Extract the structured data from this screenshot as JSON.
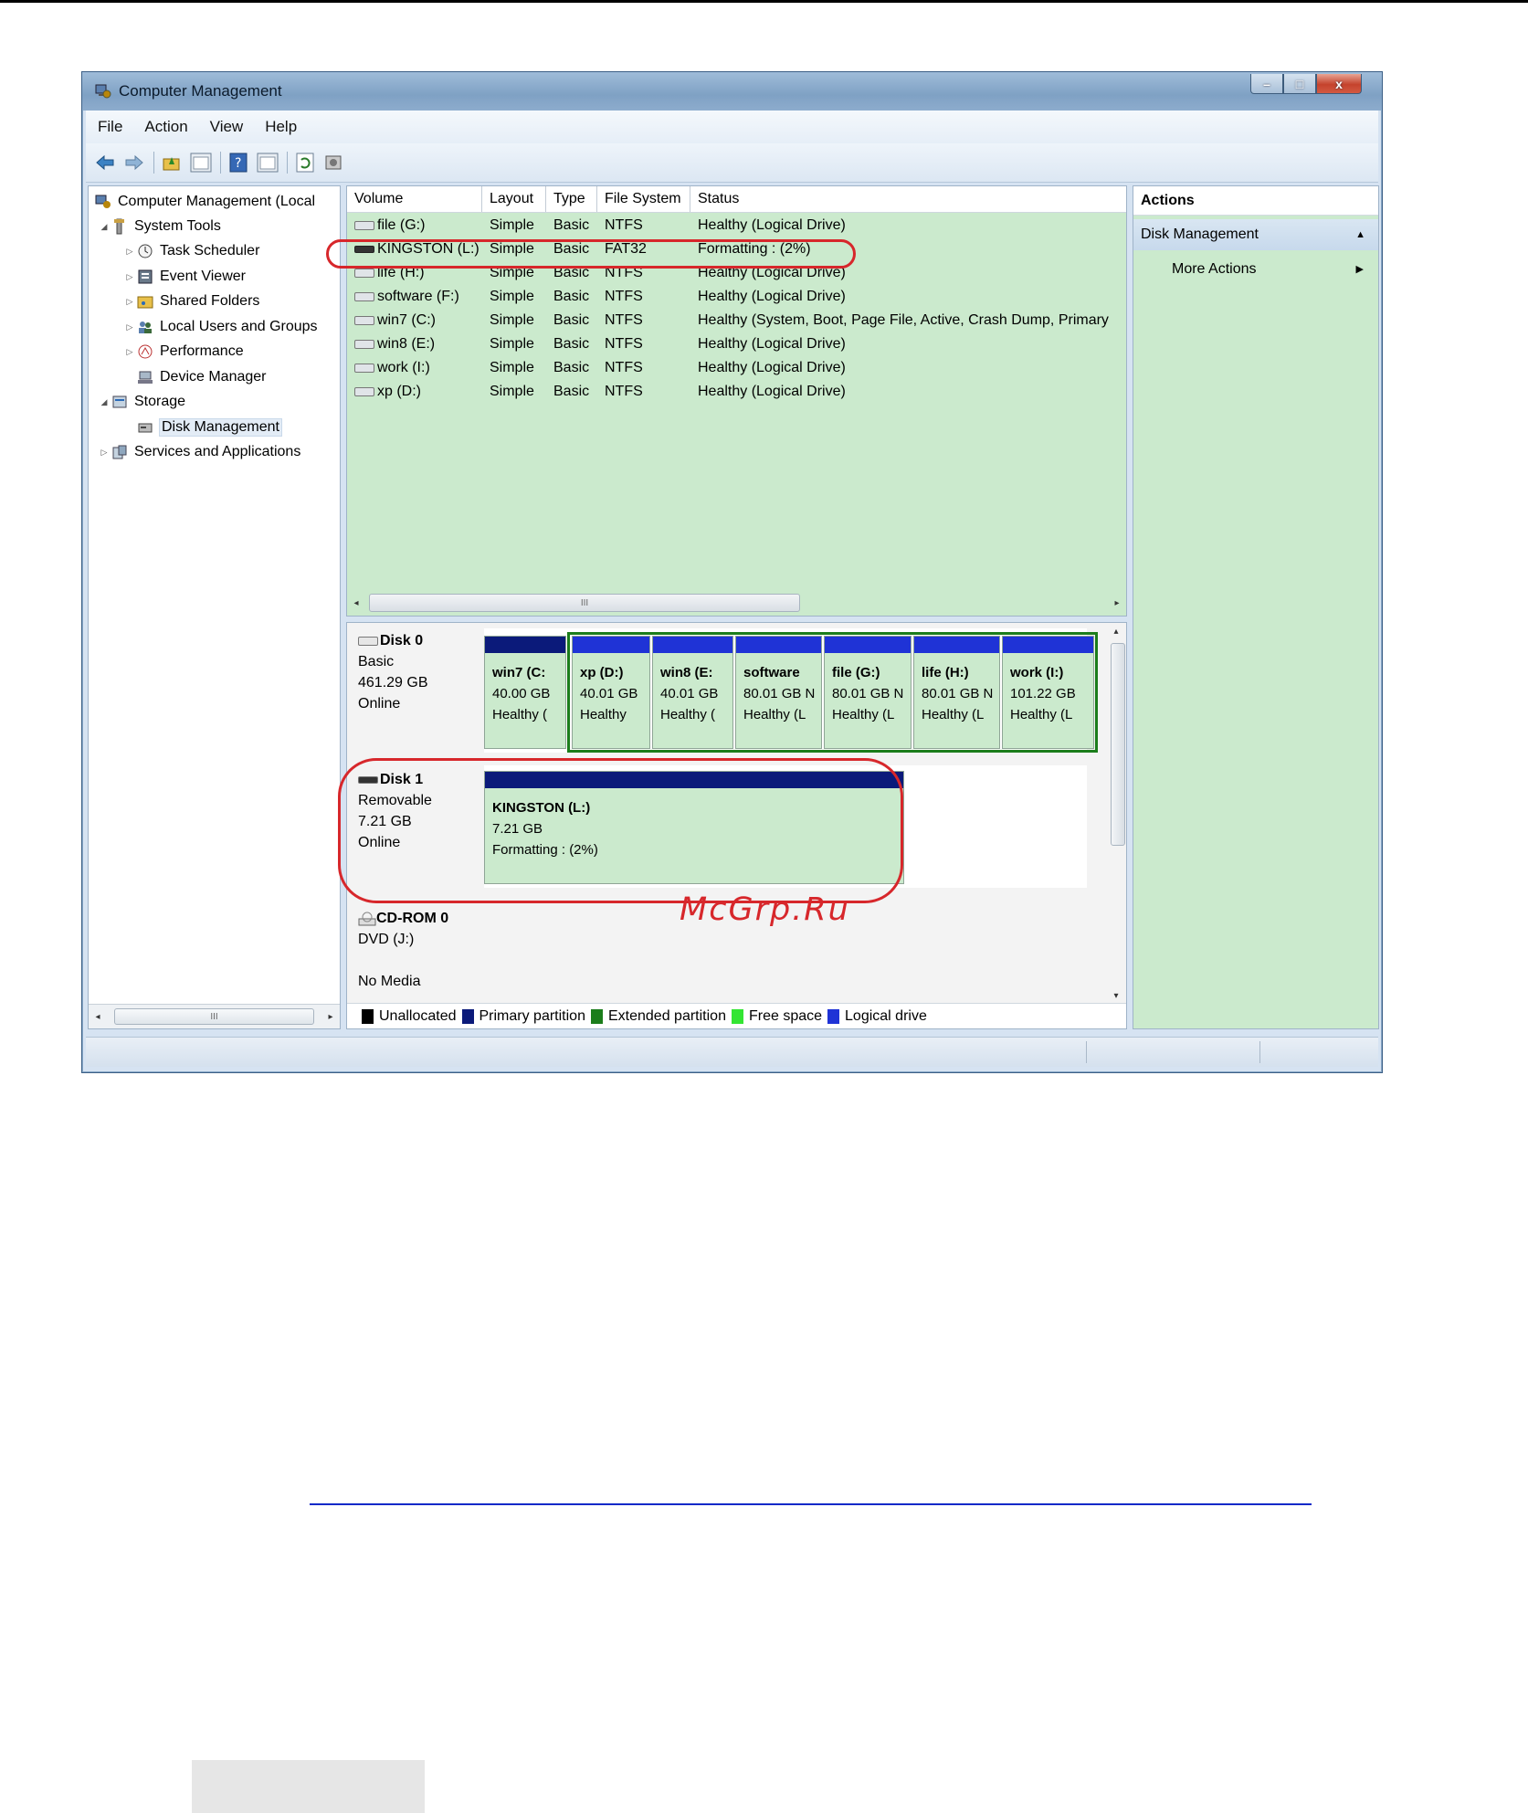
{
  "window": {
    "title": "Computer Management",
    "caption": {
      "minimize": "–",
      "maximize": "□",
      "close": "x"
    }
  },
  "menu": [
    "File",
    "Action",
    "View",
    "Help"
  ],
  "tree": {
    "root": "Computer Management (Local",
    "system_tools": "System Tools",
    "task_scheduler": "Task Scheduler",
    "event_viewer": "Event Viewer",
    "shared_folders": "Shared Folders",
    "local_users": "Local Users and Groups",
    "performance": "Performance",
    "device_manager": "Device Manager",
    "storage": "Storage",
    "disk_management": "Disk Management",
    "services": "Services and Applications",
    "scroll_thumb": "III"
  },
  "volumes": {
    "columns": [
      "Volume",
      "Layout",
      "Type",
      "File System",
      "Status"
    ],
    "rows": [
      {
        "volume": "file (G:)",
        "layout": "Simple",
        "type": "Basic",
        "fs": "NTFS",
        "status": "Healthy (Logical Drive)"
      },
      {
        "volume": "KINGSTON (L:)",
        "layout": "Simple",
        "type": "Basic",
        "fs": "FAT32",
        "status": "Formatting : (2%)"
      },
      {
        "volume": "life (H:)",
        "layout": "Simple",
        "type": "Basic",
        "fs": "NTFS",
        "status": "Healthy (Logical Drive)"
      },
      {
        "volume": "software (F:)",
        "layout": "Simple",
        "type": "Basic",
        "fs": "NTFS",
        "status": "Healthy (Logical Drive)"
      },
      {
        "volume": "win7 (C:)",
        "layout": "Simple",
        "type": "Basic",
        "fs": "NTFS",
        "status": "Healthy (System, Boot, Page File, Active, Crash Dump, Primary"
      },
      {
        "volume": "win8 (E:)",
        "layout": "Simple",
        "type": "Basic",
        "fs": "NTFS",
        "status": "Healthy (Logical Drive)"
      },
      {
        "volume": "work (I:)",
        "layout": "Simple",
        "type": "Basic",
        "fs": "NTFS",
        "status": "Healthy (Logical Drive)"
      },
      {
        "volume": "xp (D:)",
        "layout": "Simple",
        "type": "Basic",
        "fs": "NTFS",
        "status": "Healthy (Logical Drive)"
      }
    ],
    "scroll_thumb": "III"
  },
  "disks": {
    "disk0": {
      "name": "Disk 0",
      "kind": "Basic",
      "size": "461.29 GB",
      "state": "Online",
      "partitions": [
        {
          "name": "win7  (C:",
          "size": "40.00 GB",
          "status": "Healthy ("
        },
        {
          "name": "xp  (D:)",
          "size": "40.01 GB",
          "status": "Healthy"
        },
        {
          "name": "win8  (E:",
          "size": "40.01 GB",
          "status": "Healthy ("
        },
        {
          "name": "software",
          "size": "80.01 GB N",
          "status": "Healthy (L"
        },
        {
          "name": "file  (G:)",
          "size": "80.01 GB N",
          "status": "Healthy (L"
        },
        {
          "name": "life  (H:)",
          "size": "80.01 GB N",
          "status": "Healthy (L"
        },
        {
          "name": "work  (I:)",
          "size": "101.22 GB",
          "status": "Healthy (L"
        }
      ]
    },
    "disk1": {
      "name": "Disk 1",
      "kind": "Removable",
      "size": "7.21 GB",
      "state": "Online",
      "partition": {
        "name": "KINGSTON  (L:)",
        "size": "7.21 GB",
        "status": "Formatting : (2%)"
      }
    },
    "cdrom": {
      "name": "CD-ROM 0",
      "kind": "DVD (J:)",
      "state": "No Media"
    }
  },
  "legend": [
    {
      "label": "Unallocated",
      "color": "#000000"
    },
    {
      "label": "Primary partition",
      "color": "#0b1a7a"
    },
    {
      "label": "Extended partition",
      "color": "#1b7d1b"
    },
    {
      "label": "Free space",
      "color": "#33e533"
    },
    {
      "label": "Logical drive",
      "color": "#1f33d6"
    }
  ],
  "actions": {
    "title": "Actions",
    "section": "Disk Management",
    "more": "More Actions"
  },
  "watermark": "McGrp.Ru",
  "colors": {
    "partition_fill": "#cbeacd",
    "primary_bar": "#0b1a7a",
    "logical_bar": "#1f33d6",
    "extended_frame": "#1b7d1b",
    "highlight": "#d7272b"
  }
}
